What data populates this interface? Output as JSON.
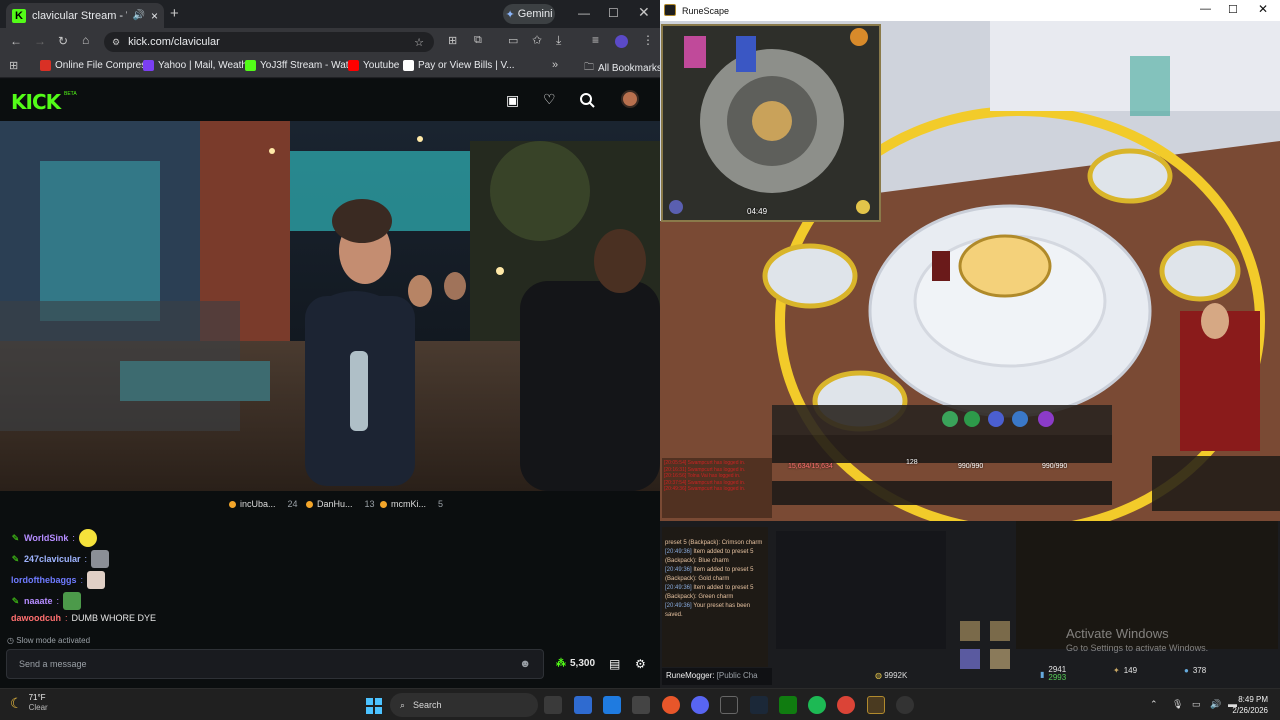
{
  "browser": {
    "tab_title": "clavicular Stream - Watch L",
    "gemini_label": "Gemini",
    "url": "kick.com/clavicular",
    "bookmarks": [
      {
        "label": "Online File Compres...",
        "color": "#d93025"
      },
      {
        "label": "Yahoo | Mail, Weath...",
        "color": "#7b3ff2"
      },
      {
        "label": "YoJ3ff Stream - Wat...",
        "color": "#53fc18"
      },
      {
        "label": "Youtube",
        "color": "#ff0000"
      },
      {
        "label": "Pay or View Bills | V...",
        "color": "#ffffff"
      }
    ],
    "all_bookmarks_label": "All Bookmarks"
  },
  "kick": {
    "logo": "KICK",
    "beta": "BETA",
    "leaderboard": [
      {
        "name": "incUba...",
        "count": "24"
      },
      {
        "name": "DanHu...",
        "count": "13"
      },
      {
        "name": "mcmKi...",
        "count": "5"
      }
    ],
    "chat": [
      {
        "user": "WorldSink",
        "color": "#b58cff",
        "text": "",
        "emote_color": "#f5e23b"
      },
      {
        "user": "247clavicular",
        "color": "#9fb4ff",
        "text": "",
        "emote_color": "#8b8f96"
      },
      {
        "user": "lordofthebaggs",
        "color": "#6f7bff",
        "text": "",
        "emote_color": "#e0cfc5"
      },
      {
        "user": "naaate",
        "color": "#b58cff",
        "text": "",
        "emote_color": "#4c9a4a"
      },
      {
        "user": "dawoodcuh",
        "color": "#ff6f6f",
        "text": "DUMB WHORE DYE",
        "emote_color": ""
      }
    ],
    "slow_mode": "Slow mode activated",
    "input_placeholder": "Send a message",
    "points": "5,300"
  },
  "runescape": {
    "window_title": "RuneScape",
    "minimap_timer": "04:49",
    "hud": {
      "lifepoints": "15,634/15,634",
      "run": "128",
      "prayer": "990/990",
      "adrenaline": "990/990"
    },
    "game_chatlog": [
      "[20:05:54] Swampcurt has logged in.",
      "[20:16:31] Swampcurt has logged in.",
      "[20:16:56] Tolna Vai has logged in.",
      "[20:37:54] Swampcurt has logged in.",
      "[20:49:36] Swampcurt has logged in."
    ],
    "chat_messages": [
      {
        "time": "",
        "text": "preset 5 (Backpack): Crimson charm"
      },
      {
        "time": "[20:49:36]",
        "text": "Item added to preset 5 (Backpack): Blue charm"
      },
      {
        "time": "[20:49:36]",
        "text": "Item added to preset 5 (Backpack): Gold charm"
      },
      {
        "time": "[20:49:36]",
        "text": "Item added to preset 5 (Backpack): Green charm"
      },
      {
        "time": "[20:49:36]",
        "text": "Your preset has been saved."
      }
    ],
    "chat_input_name": "RuneMogger",
    "chat_channel": "[Public Cha",
    "money": "9992K",
    "stats_bottom": [
      {
        "value": "2941",
        "sub": "2993"
      },
      {
        "value": "149"
      },
      {
        "value": "378"
      }
    ],
    "activate_title": "Activate Windows",
    "activate_sub": "Go to Settings to activate Windows."
  },
  "taskbar": {
    "temp": "71°F",
    "condition": "Clear",
    "search_label": "Search",
    "time": "8:49 PM",
    "date": "2/26/2026"
  }
}
